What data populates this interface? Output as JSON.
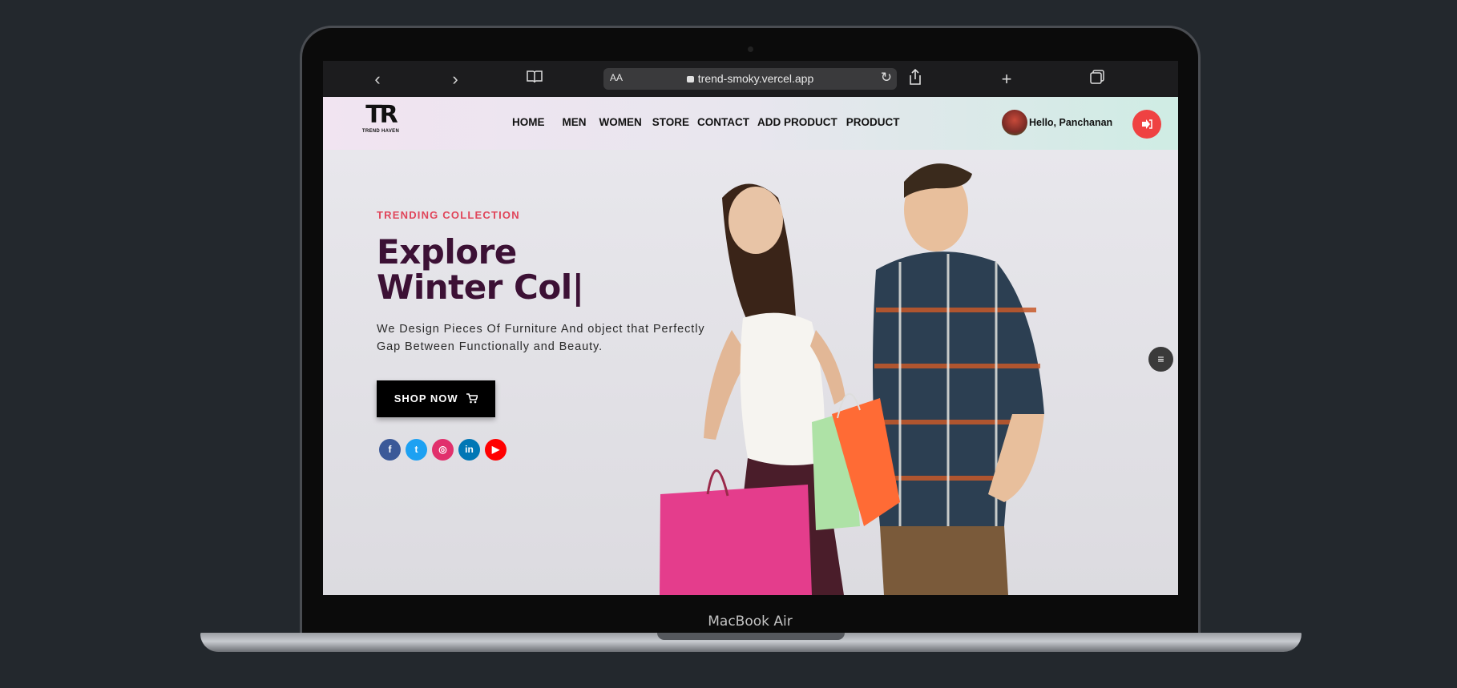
{
  "device": {
    "brand_label": "MacBook Air"
  },
  "browser": {
    "url": "trend-smoky.vercel.app",
    "reader_label": "AA",
    "icons": [
      "chevron-left-icon",
      "chevron-right-icon",
      "book-icon",
      "share-icon",
      "plus-icon",
      "tabs-icon",
      "reload-icon",
      "lock-icon"
    ]
  },
  "site": {
    "logo": {
      "mark": "TR",
      "text": "TREND HAVEN"
    },
    "nav": [
      "HOME",
      "MEN",
      "WOMEN",
      "STORE",
      "CONTACT",
      "ADD PRODUCT",
      "PRODUCT"
    ],
    "user_greeting": "Hello, Panchanan",
    "logout_icon": "logout-icon"
  },
  "hero": {
    "eyebrow": "TRENDING COLLECTION",
    "headline": "Explore Winter Col|",
    "lead": "We Design Pieces Of Furniture And object that Perfectly Gap Between Functionally and Beauty.",
    "cta": "SHOP NOW",
    "cta_icon": "cart-icon",
    "socials": [
      {
        "name": "facebook-icon",
        "glyph": "f",
        "color": "#3b5998"
      },
      {
        "name": "twitter-icon",
        "glyph": "t",
        "color": "#1da1f2"
      },
      {
        "name": "instagram-icon",
        "glyph": "◎",
        "color": "#e1306c"
      },
      {
        "name": "linkedin-icon",
        "glyph": "in",
        "color": "#0077b5"
      },
      {
        "name": "youtube-icon",
        "glyph": "▶",
        "color": "#ff0000"
      }
    ]
  },
  "colors": {
    "accent": "#e0455a",
    "headline": "#3c1135",
    "logout": "#ef4242"
  }
}
